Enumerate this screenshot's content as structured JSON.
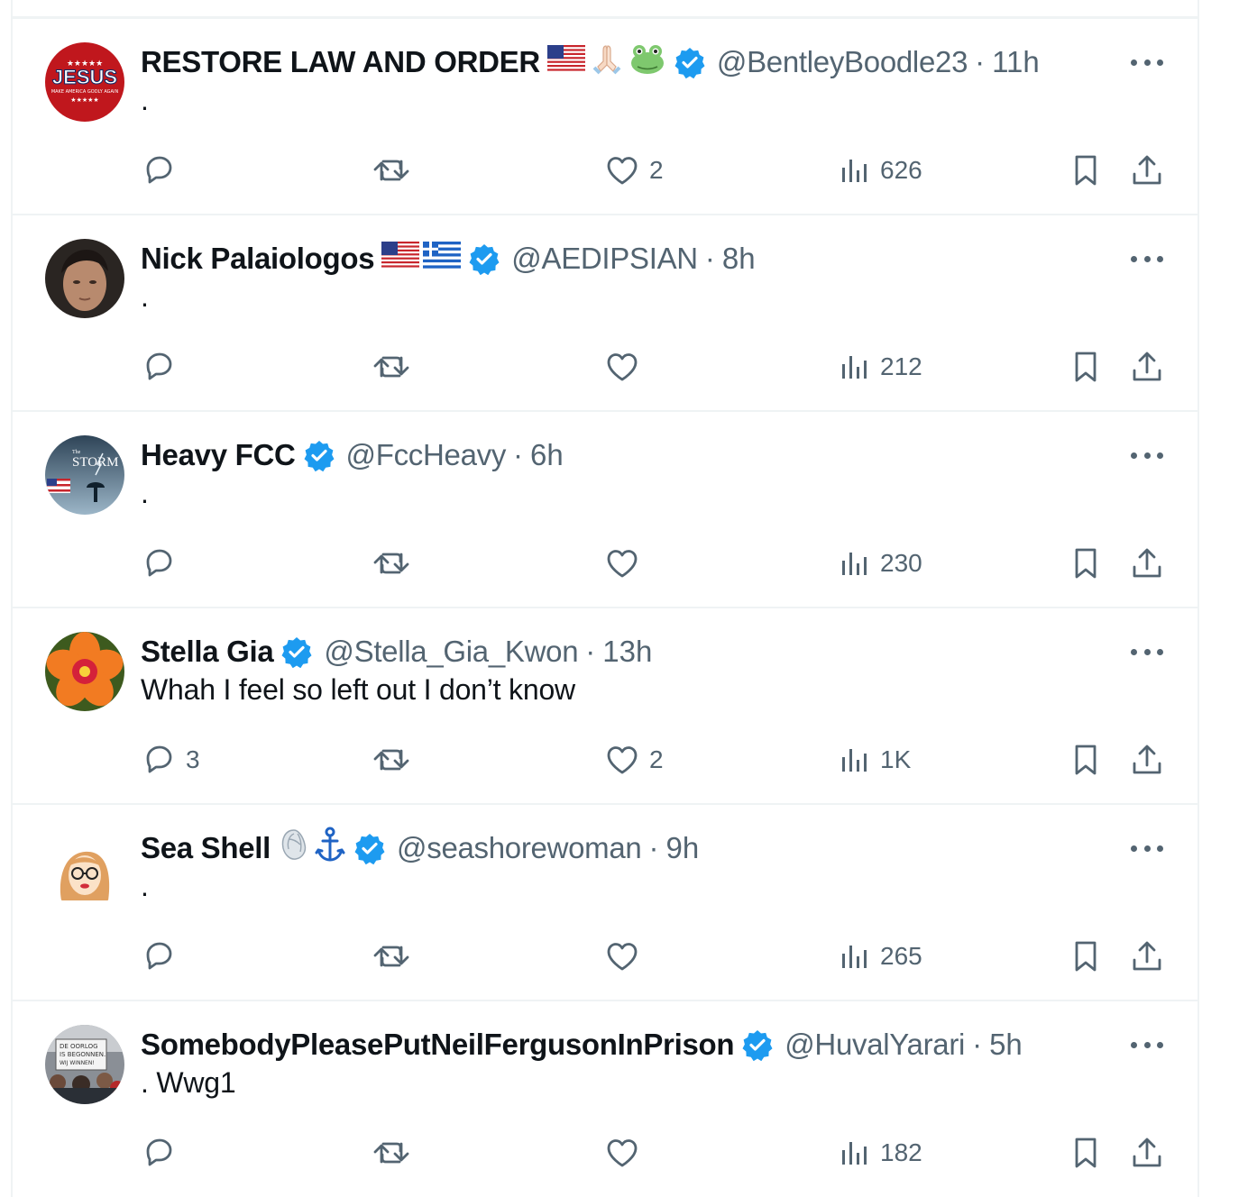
{
  "tweets": [
    {
      "name": "RESTORE LAW AND ORDER",
      "emojis": [
        "us-flag",
        "folded-hands",
        "frog"
      ],
      "handle": "@BentleyBoodle23",
      "sep": "·",
      "time": "11h",
      "text": ".",
      "replies": "",
      "likes": "2",
      "views": "626",
      "avatar": {
        "kind": "jesus",
        "bg": "#c0171d",
        "text": "JESUS",
        "subtext": "MAKE AMERICA GODLY AGAIN"
      }
    },
    {
      "name": "Nick Palaiologos",
      "emojis": [
        "us-flag",
        "greece-flag"
      ],
      "handle": "@AEDIPSIAN",
      "sep": "·",
      "time": "8h",
      "text": ".",
      "replies": "",
      "likes": "",
      "views": "212",
      "avatar": {
        "kind": "portrait",
        "bg": "#2a2522"
      }
    },
    {
      "name": "Heavy FCC",
      "emojis": [],
      "handle": "@FccHeavy",
      "sep": "·",
      "time": "6h",
      "text": ".",
      "replies": "",
      "likes": "",
      "views": "230",
      "avatar": {
        "kind": "storm",
        "bg": "#4b6a84",
        "text": "STORM",
        "subtext": "The"
      }
    },
    {
      "name": "Stella Gia",
      "emojis": [],
      "handle": "@Stella_Gia_Kwon",
      "sep": "·",
      "time": "13h",
      "text": "Whah I feel so left out I don’t know",
      "replies": "3",
      "likes": "2",
      "views": "1K",
      "avatar": {
        "kind": "hibiscus",
        "bg": "#3d5a1e"
      }
    },
    {
      "name": "Sea Shell",
      "emojis": [
        "spiral-shell",
        "anchor"
      ],
      "handle": "@seashorewoman",
      "sep": "·",
      "time": "9h",
      "text": ".",
      "replies": "",
      "likes": "",
      "views": "265",
      "avatar": {
        "kind": "cartoon",
        "bg": "#ffffff"
      }
    },
    {
      "name": "SomebodyPleasePutNeilFergusonInPrison",
      "emojis": [],
      "handle": "@HuvalYarari",
      "sep": "·",
      "time": "5h",
      "text": ". Wwg1",
      "replies": "",
      "likes": "",
      "views": "182",
      "avatar": {
        "kind": "protest",
        "bg": "#8a8f96",
        "text": "DE OORLOG IS BEGONNEN. WIJ WINNEN!"
      }
    }
  ],
  "colors": {
    "verified": "#1d9bf0",
    "text": "#0f1419",
    "muted": "#536471",
    "divider": "#eff3f4"
  },
  "icons": {
    "reply": "reply-icon",
    "retweet": "retweet-icon",
    "like": "heart-icon",
    "views": "views-icon",
    "bookmark": "bookmark-icon",
    "share": "share-icon",
    "more": "more-icon",
    "verified": "verified-badge-icon"
  }
}
